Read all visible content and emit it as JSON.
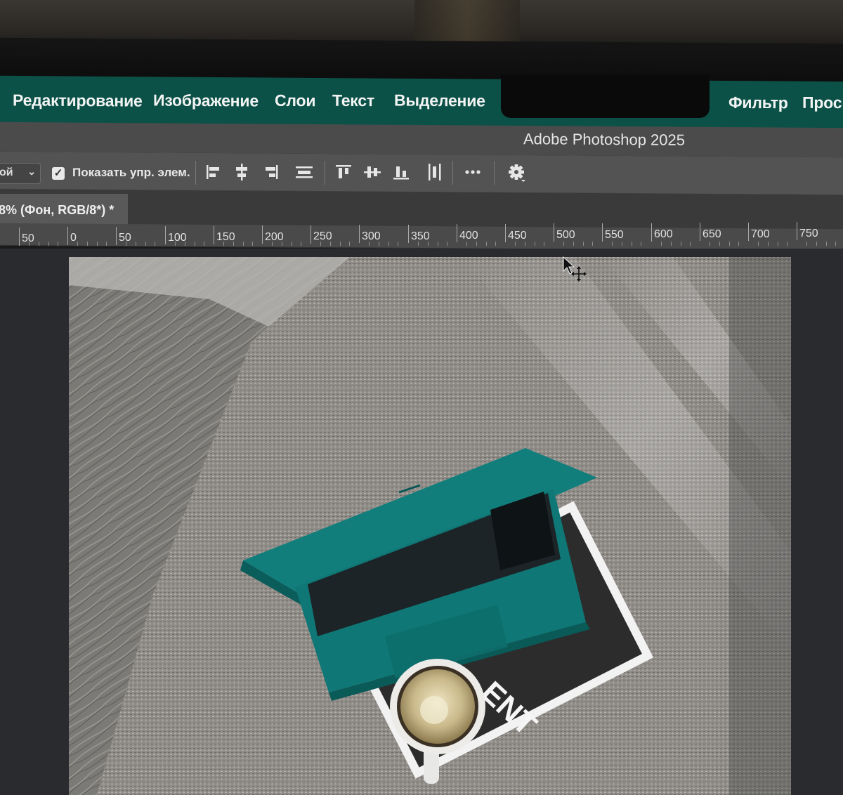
{
  "menu": {
    "items": [
      "Редактирование",
      "Изображение",
      "Слои",
      "Текст",
      "Выделение",
      "Фильтр",
      "Просм"
    ]
  },
  "window": {
    "title": "Adobe Photoshop 2025"
  },
  "options_bar": {
    "auto_select_value": "ой",
    "show_transform_label": "Показать упр. элем.",
    "show_transform_checked": true,
    "icons": [
      "align-left-edges-icon",
      "align-horizontal-centers-icon",
      "align-right-edges-icon",
      "distribute-vertical-icon",
      "align-top-edges-icon",
      "align-vertical-centers-icon",
      "align-bottom-edges-icon",
      "distribute-horizontal-icon",
      "more-options-icon",
      "settings-gear-icon"
    ]
  },
  "document": {
    "tab_label": "8% (Фон, RGB/8*) *"
  },
  "ruler": {
    "labels": [
      "50",
      "0",
      "50",
      "100",
      "150",
      "200",
      "250",
      "300",
      "350",
      "400",
      "450",
      "500",
      "550",
      "600",
      "650",
      "700",
      "750"
    ]
  },
  "colors": {
    "menubar": "#0c5148",
    "laptop": "#0f7c7a",
    "workspace": "#2a2b2e"
  },
  "canvas": {
    "magazine_text": "ENT"
  }
}
